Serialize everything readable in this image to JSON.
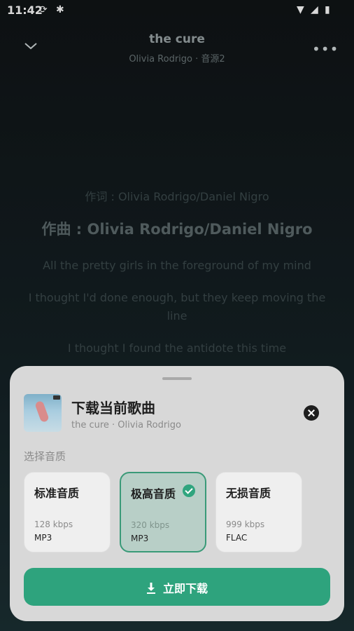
{
  "status_bar": {
    "time": "11:42"
  },
  "header": {
    "title": "the cure",
    "subtitle": "Olivia Rodrigo · 音源2"
  },
  "lyrics": [
    "作词 : Olivia Rodrigo/Daniel Nigro",
    "作曲 : Olivia Rodrigo/Daniel Nigro",
    "All the pretty girls in the foreground of my mind",
    "I thought I'd done enough, but they keep moving the line",
    "I thought I found the antidote this time"
  ],
  "sheet": {
    "title": "下载当前歌曲",
    "subtitle": "the cure · Olivia Rodrigo",
    "section_label": "选择音质",
    "qualities": [
      {
        "name": "标准音质",
        "bitrate": "128 kbps",
        "format": "MP3",
        "selected": false
      },
      {
        "name": "极高音质",
        "bitrate": "320 kbps",
        "format": "MP3",
        "selected": true
      },
      {
        "name": "无损音质",
        "bitrate": "999 kbps",
        "format": "FLAC",
        "selected": false
      }
    ],
    "download_label": "立即下载"
  },
  "colors": {
    "accent": "#2ea37d",
    "sheet_bg": "#d8d8d8"
  }
}
